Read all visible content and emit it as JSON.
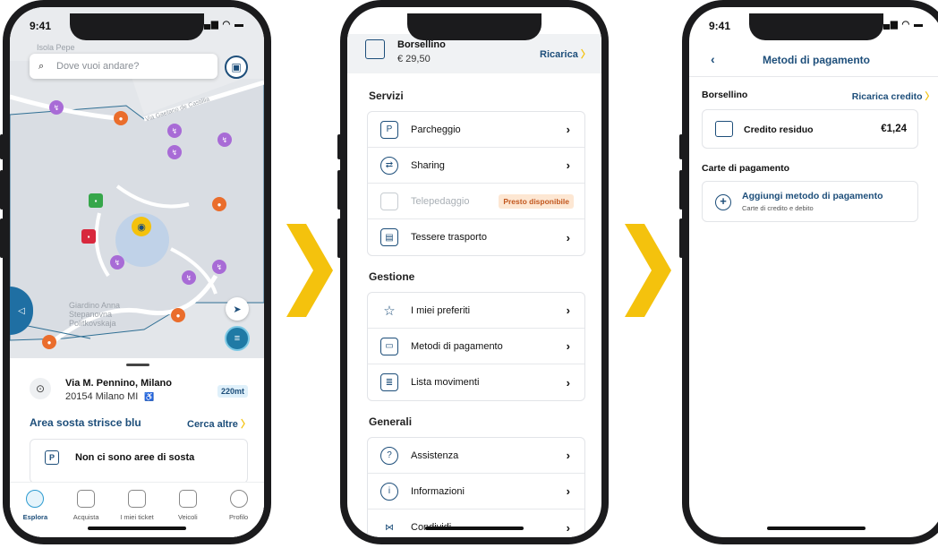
{
  "phone1": {
    "status_time": "9:41",
    "search": {
      "placeholder": "Dove vuoi andare?"
    },
    "map_labels": {
      "top": "Isola Pepe",
      "street": "Via Gaetano de Castillia",
      "park": "Giardino Anna Stepanovna Politkovskaja"
    },
    "sheet": {
      "address_title": "Via M. Pennino, Milano",
      "address_sub": "20154 Milano MI",
      "accessible_icon": "♿",
      "distance": "220mt",
      "area_title": "Area sosta strisce blu",
      "cerca_label": "Cerca altre",
      "no_area_text": "Non ci sono aree di sosta",
      "p_icon": "P"
    },
    "tabs": [
      {
        "label": "Esplora",
        "icon": "map-pin-icon"
      },
      {
        "label": "Acquista",
        "icon": "shop-icon"
      },
      {
        "label": "I miei ticket",
        "icon": "ticket-icon"
      },
      {
        "label": "Veicoli",
        "icon": "car-icon"
      },
      {
        "label": "Profilo",
        "icon": "profile-icon"
      }
    ]
  },
  "phone2": {
    "wallet_title": "Borsellino",
    "wallet_amount": "€ 29,50",
    "ricarica_label": "Ricarica",
    "sections": {
      "servizi": "Servizi",
      "gestione": "Gestione",
      "generali": "Generali"
    },
    "servizi_items": [
      {
        "label": "Parcheggio",
        "icon": "parking-icon"
      },
      {
        "label": "Sharing",
        "icon": "sharing-icon"
      },
      {
        "label": "Telepedaggio",
        "icon": "toll-icon",
        "badge": "Presto disponibile"
      },
      {
        "label": "Tessere trasporto",
        "icon": "transport-card-icon"
      }
    ],
    "gestione_items": [
      {
        "label": "I miei preferiti",
        "icon": "star-icon"
      },
      {
        "label": "Metodi di pagamento",
        "icon": "card-icon"
      },
      {
        "label": "Lista movimenti",
        "icon": "list-icon"
      }
    ],
    "generali_items": [
      {
        "label": "Assistenza",
        "icon": "support-icon"
      },
      {
        "label": "Informazioni",
        "icon": "info-icon"
      },
      {
        "label": "Condividi",
        "icon": "share-icon"
      }
    ]
  },
  "phone3": {
    "status_time": "9:41",
    "title": "Metodi di pagamento",
    "borsellino_label": "Borsellino",
    "ricarica_credito": "Ricarica credito",
    "credito_label": "Credito residuo",
    "credito_value": "€1,24",
    "carte_label": "Carte di pagamento",
    "add_title": "Aggiungi metodo di pagamento",
    "add_sub": "Carte di credito e debito"
  },
  "colors": {
    "primary": "#1d4e7a",
    "accent_yellow": "#f4c20d",
    "badge_bg": "#fde7d3",
    "badge_text": "#c2571e"
  }
}
